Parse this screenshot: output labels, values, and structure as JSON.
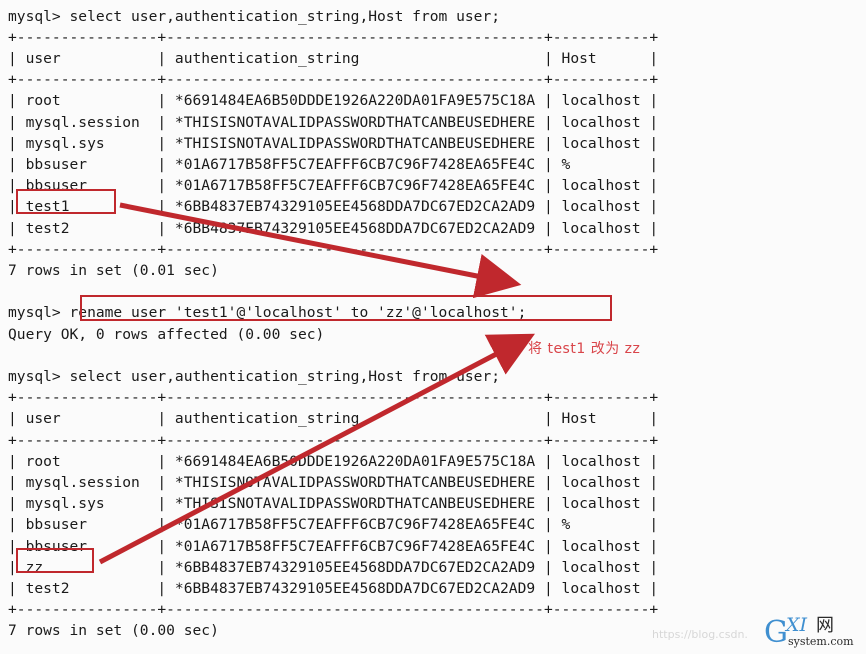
{
  "terminal": {
    "prompt": "mysql> ",
    "lines": [
      "mysql> select user,authentication_string,Host from user;",
      "+----------------+-------------------------------------------+-----------+",
      "| user           | authentication_string                     | Host      |",
      "+----------------+-------------------------------------------+-----------+",
      "| root           | *6691484EA6B50DDDE1926A220DA01FA9E575C18A | localhost |",
      "| mysql.session  | *THISISNOTAVALIDPASSWORDTHATCANBEUSEDHERE | localhost |",
      "| mysql.sys      | *THISISNOTAVALIDPASSWORDTHATCANBEUSEDHERE | localhost |",
      "| bbsuser        | *01A6717B58FF5C7EAFFF6CB7C96F7428EA65FE4C | %         |",
      "| bbsuser        | *01A6717B58FF5C7EAFFF6CB7C96F7428EA65FE4C | localhost |",
      "| test1          | *6BB4837EB74329105EE4568DDA7DC67ED2CA2AD9 | localhost |",
      "| test2          | *6BB4837EB74329105EE4568DDA7DC67ED2CA2AD9 | localhost |",
      "+----------------+-------------------------------------------+-----------+",
      "7 rows in set (0.01 sec)",
      "",
      "mysql> rename user 'test1'@'localhost' to 'zz'@'localhost';",
      "Query OK, 0 rows affected (0.00 sec)",
      "",
      "mysql> select user,authentication_string,Host from user;",
      "+----------------+-------------------------------------------+-----------+",
      "| user           | authentication_string                     | Host      |",
      "+----------------+-------------------------------------------+-----------+",
      "| root           | *6691484EA6B50DDDE1926A220DA01FA9E575C18A | localhost |",
      "| mysql.session  | *THISISNOTAVALIDPASSWORDTHATCANBEUSEDHERE | localhost |",
      "| mysql.sys      | *THISISNOTAVALIDPASSWORDTHATCANBEUSEDHERE | localhost |",
      "| bbsuser        | *01A6717B58FF5C7EAFFF6CB7C96F7428EA65FE4C | %         |",
      "| bbsuser        | *01A6717B58FF5C7EAFFF6CB7C96F7428EA65FE4C | localhost |",
      "| zz             | *6BB4837EB74329105EE4568DDA7DC67ED2CA2AD9 | localhost |",
      "| test2          | *6BB4837EB74329105EE4568DDA7DC67ED2CA2AD9 | localhost |",
      "+----------------+-------------------------------------------+-----------+",
      "7 rows in set (0.00 sec)"
    ],
    "columns": [
      "user",
      "authentication_string",
      "Host"
    ],
    "query_select": "select user,authentication_string,Host from user;",
    "query_rename": "rename user 'test1'@'localhost' to 'zz'@'localhost';",
    "result_rename": "Query OK, 0 rows affected (0.00 sec)",
    "result_count_first": "7 rows in set (0.01 sec)",
    "result_count_second": "7 rows in set (0.00 sec)",
    "table_before": {
      "rows": [
        {
          "user": "root",
          "authentication_string": "*6691484EA6B50DDDE1926A220DA01FA9E575C18A",
          "host": "localhost"
        },
        {
          "user": "mysql.session",
          "authentication_string": "*THISISNOTAVALIDPASSWORDTHATCANBEUSEDHERE",
          "host": "localhost"
        },
        {
          "user": "mysql.sys",
          "authentication_string": "*THISISNOTAVALIDPASSWORDTHATCANBEUSEDHERE",
          "host": "localhost"
        },
        {
          "user": "bbsuser",
          "authentication_string": "*01A6717B58FF5C7EAFFF6CB7C96F7428EA65FE4C",
          "host": "%"
        },
        {
          "user": "bbsuser",
          "authentication_string": "*01A6717B58FF5C7EAFFF6CB7C96F7428EA65FE4C",
          "host": "localhost"
        },
        {
          "user": "test1",
          "authentication_string": "*6BB4837EB74329105EE4568DDA7DC67ED2CA2AD9",
          "host": "localhost"
        },
        {
          "user": "test2",
          "authentication_string": "*6BB4837EB74329105EE4568DDA7DC67ED2CA2AD9",
          "host": "localhost"
        }
      ]
    },
    "table_after": {
      "rows": [
        {
          "user": "root",
          "authentication_string": "*6691484EA6B50DDDE1926A220DA01FA9E575C18A",
          "host": "localhost"
        },
        {
          "user": "mysql.session",
          "authentication_string": "*THISISNOTAVALIDPASSWORDTHATCANBEUSEDHERE",
          "host": "localhost"
        },
        {
          "user": "mysql.sys",
          "authentication_string": "*THISISNOTAVALIDPASSWORDTHATCANBEUSEDHERE",
          "host": "localhost"
        },
        {
          "user": "bbsuser",
          "authentication_string": "*01A6717B58FF5C7EAFFF6CB7C96F7428EA65FE4C",
          "host": "%"
        },
        {
          "user": "bbsuser",
          "authentication_string": "*01A6717B58FF5C7EAFFF6CB7C96F7428EA65FE4C",
          "host": "localhost"
        },
        {
          "user": "zz",
          "authentication_string": "*6BB4837EB74329105EE4568DDA7DC67ED2CA2AD9",
          "host": "localhost"
        },
        {
          "user": "test2",
          "authentication_string": "*6BB4837EB74329105EE4568DDA7DC67ED2CA2AD9",
          "host": "localhost"
        }
      ]
    }
  },
  "annotations": {
    "color": "#c0282d",
    "note_color": "#d9454a",
    "note_text": "将 test1 改为 zz",
    "highlight_before": "test1",
    "highlight_rename": "rename user 'test1'@'localhost' to 'zz'@'localhost';",
    "highlight_after": "zz"
  },
  "watermark": {
    "url_text": "https://blog.csdn.",
    "logo_g": "G",
    "logo_xi": "XI",
    "logo_cn": "网",
    "logo_sys": "system.com",
    "color": "#d7d7d7"
  }
}
